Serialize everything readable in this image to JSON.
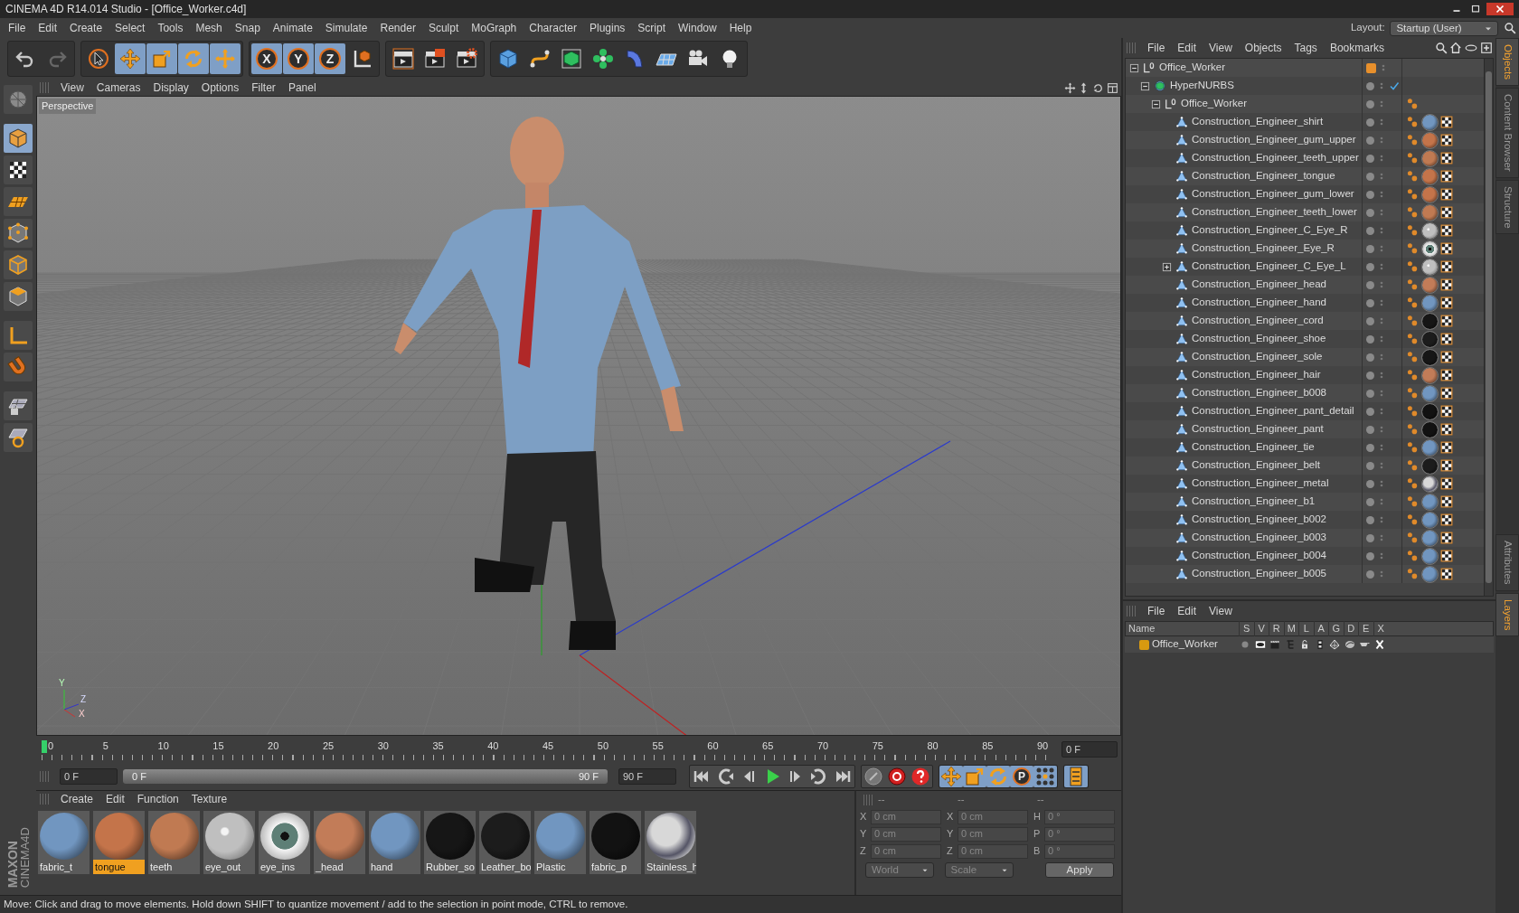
{
  "window": {
    "title": "CINEMA 4D R14.014 Studio - [Office_Worker.c4d]",
    "layout_label": "Layout:",
    "layout_value": "Startup (User)"
  },
  "menu": [
    "File",
    "Edit",
    "Create",
    "Select",
    "Tools",
    "Mesh",
    "Snap",
    "Animate",
    "Simulate",
    "Render",
    "Sculpt",
    "MoGraph",
    "Character",
    "Plugins",
    "Script",
    "Window",
    "Help"
  ],
  "toolbar": [
    [
      {
        "kind": "undo",
        "on": false,
        "disabled": false
      },
      {
        "kind": "redo",
        "on": false,
        "disabled": true
      }
    ],
    [
      {
        "kind": "select",
        "on": false
      },
      {
        "kind": "move",
        "on": true
      },
      {
        "kind": "scale",
        "on": true
      },
      {
        "kind": "rotate",
        "on": true
      },
      {
        "kind": "add",
        "on": true
      }
    ],
    [
      {
        "kind": "axis",
        "label": "X",
        "on": true
      },
      {
        "kind": "axis",
        "label": "Y",
        "on": true
      },
      {
        "kind": "axis",
        "label": "Z",
        "on": true
      },
      {
        "kind": "coord",
        "on": false
      }
    ],
    [
      {
        "kind": "render-view",
        "on": false
      },
      {
        "kind": "render-picture",
        "on": false
      },
      {
        "kind": "render-settings",
        "on": false
      }
    ],
    [
      {
        "kind": "cube",
        "on": false
      },
      {
        "kind": "spline",
        "on": false
      },
      {
        "kind": "nurbs",
        "on": false
      },
      {
        "kind": "array",
        "on": false
      },
      {
        "kind": "deformer",
        "on": false
      },
      {
        "kind": "floor",
        "on": false
      },
      {
        "kind": "camera",
        "on": false
      },
      {
        "kind": "light",
        "on": false
      }
    ]
  ],
  "tools": [
    {
      "kind": "editable",
      "on": false
    },
    {
      "kind": "model",
      "on": true
    },
    {
      "kind": "texture",
      "on": false
    },
    {
      "kind": "workplane",
      "on": false
    },
    {
      "kind": "points",
      "on": false
    },
    {
      "kind": "edges",
      "on": false
    },
    {
      "kind": "polygons",
      "on": false
    },
    {
      "kind": "axis-mode",
      "on": false
    },
    {
      "kind": "tweak",
      "on": false
    },
    {
      "kind": "snap",
      "on": false
    },
    {
      "kind": "snap-rotate",
      "on": false
    }
  ],
  "logo": {
    "brand": "MAXON",
    "product": "CINEMA4D"
  },
  "viewport": {
    "menu": [
      "View",
      "Cameras",
      "Display",
      "Options",
      "Filter",
      "Panel"
    ],
    "camera": "Perspective",
    "axis_labels": [
      "Y",
      "Z",
      "X"
    ]
  },
  "timeline": {
    "ticks": [
      "0",
      "5",
      "10",
      "15",
      "20",
      "25",
      "30",
      "35",
      "40",
      "45",
      "50",
      "55",
      "60",
      "65",
      "70",
      "75",
      "80",
      "85",
      "90"
    ],
    "playhead": {
      "level": 0
    },
    "frame_field": "0 F"
  },
  "playback": {
    "start_field": "0 F",
    "range_start": "0 F",
    "range_end": "90 F",
    "range": {
      "level": 1
    },
    "end_field": "90 F",
    "groups": [
      [
        {
          "kind": "to-start",
          "on": false
        },
        {
          "kind": "prev-key",
          "on": false
        },
        {
          "kind": "prev-frame",
          "on": false
        },
        {
          "kind": "play",
          "on": false
        },
        {
          "kind": "next-frame",
          "on": false
        },
        {
          "kind": "next-key",
          "on": false
        },
        {
          "kind": "to-end",
          "on": false
        }
      ],
      [
        {
          "kind": "key-off",
          "on": false
        },
        {
          "kind": "record",
          "on": false
        },
        {
          "kind": "autokey",
          "on": false
        }
      ],
      [
        {
          "kind": "move",
          "on": true
        },
        {
          "kind": "scale",
          "on": true
        },
        {
          "kind": "rotate",
          "on": true
        },
        {
          "kind": "param",
          "label": "P",
          "on": true
        },
        {
          "kind": "points-key",
          "on": true
        }
      ],
      [
        {
          "kind": "film",
          "on": true
        }
      ]
    ]
  },
  "materials": {
    "menu": [
      "Create",
      "Edit",
      "Function",
      "Texture"
    ],
    "items": [
      {
        "name": "fabric_t",
        "kind": "matte",
        "color": "#7196c0",
        "selected": false
      },
      {
        "name": "tongue",
        "kind": "matte",
        "color": "#c4744a",
        "selected": true
      },
      {
        "name": "teeth",
        "kind": "matte",
        "color": "#c07a52",
        "selected": false
      },
      {
        "name": "eye_out",
        "kind": "glass",
        "color": "#bfbfbf",
        "selected": false
      },
      {
        "name": "eye_ins",
        "kind": "eye",
        "color": "#5e7f76",
        "selected": false
      },
      {
        "name": "_head",
        "kind": "matte",
        "color": "#c27c58",
        "selected": false
      },
      {
        "name": "hand",
        "kind": "matte",
        "color": "#7196c0",
        "selected": false
      },
      {
        "name": "Rubber_so",
        "kind": "matte",
        "color": "#161616",
        "selected": false
      },
      {
        "name": "Leather_bo",
        "kind": "matte",
        "color": "#1c1c1c",
        "selected": false
      },
      {
        "name": "Plastic",
        "kind": "matte",
        "color": "#7196c0",
        "selected": false
      },
      {
        "name": "fabric_p",
        "kind": "matte",
        "color": "#121212",
        "selected": false
      },
      {
        "name": "Stainless_h",
        "kind": "chrome",
        "color": "#d8d8d8",
        "selected": false
      }
    ]
  },
  "coordinates": {
    "headers": [
      "--",
      "--",
      "--"
    ],
    "rows": [
      [
        {
          "label": "X",
          "value": "0 cm"
        },
        {
          "label": "X",
          "value": "0 cm"
        },
        {
          "label": "H",
          "value": "0 °"
        }
      ],
      [
        {
          "label": "Y",
          "value": "0 cm"
        },
        {
          "label": "Y",
          "value": "0 cm"
        },
        {
          "label": "P",
          "value": "0 °"
        }
      ],
      [
        {
          "label": "Z",
          "value": "0 cm"
        },
        {
          "label": "Z",
          "value": "0 cm"
        },
        {
          "label": "B",
          "value": "0 °"
        }
      ]
    ],
    "dropdowns": [
      "World",
      "Scale"
    ],
    "apply": "Apply"
  },
  "status_bar": "Move: Click and drag to move elements. Hold down SHIFT to quantize movement / add to the selection in point mode, CTRL to remove.",
  "objects": {
    "menu": [
      "File",
      "Edit",
      "View",
      "Objects",
      "Tags",
      "Bookmarks"
    ],
    "tree": [
      {
        "name": "Office_Worker",
        "kind": "null",
        "color": "#e8902c",
        "expanded": true,
        "children": [
          {
            "name": "HyperNURBS",
            "kind": "hypernurbs",
            "checked": true,
            "expanded": true,
            "children": [
              {
                "name": "Office_Worker",
                "kind": "null",
                "expanded": true,
                "tags": [
                  {
                    "kind": "texture"
                  }
                ],
                "children": [
                  {
                    "name": "Construction_Engineer_shirt",
                    "kind": "polygon",
                    "tags": [
                      {
                        "kind": "texture"
                      },
                      {
                        "kind": "matte",
                        "color": "#7196c0"
                      },
                      {
                        "kind": "uvw"
                      }
                    ]
                  },
                  {
                    "name": "Construction_Engineer_gum_upper",
                    "kind": "polygon",
                    "tags": [
                      {
                        "kind": "texture"
                      },
                      {
                        "kind": "matte",
                        "color": "#c4744a"
                      },
                      {
                        "kind": "uvw"
                      }
                    ]
                  },
                  {
                    "name": "Construction_Engineer_teeth_upper",
                    "kind": "polygon",
                    "tags": [
                      {
                        "kind": "texture"
                      },
                      {
                        "kind": "matte",
                        "color": "#c07a52"
                      },
                      {
                        "kind": "uvw"
                      }
                    ]
                  },
                  {
                    "name": "Construction_Engineer_tongue",
                    "kind": "polygon",
                    "tags": [
                      {
                        "kind": "texture"
                      },
                      {
                        "kind": "matte",
                        "color": "#c4744a"
                      },
                      {
                        "kind": "uvw"
                      }
                    ]
                  },
                  {
                    "name": "Construction_Engineer_gum_lower",
                    "kind": "polygon",
                    "tags": [
                      {
                        "kind": "texture"
                      },
                      {
                        "kind": "matte",
                        "color": "#c4744a"
                      },
                      {
                        "kind": "uvw"
                      }
                    ]
                  },
                  {
                    "name": "Construction_Engineer_teeth_lower",
                    "kind": "polygon",
                    "tags": [
                      {
                        "kind": "texture"
                      },
                      {
                        "kind": "matte",
                        "color": "#c07a52"
                      },
                      {
                        "kind": "uvw"
                      }
                    ]
                  },
                  {
                    "name": "Construction_Engineer_C_Eye_R",
                    "kind": "polygon",
                    "tags": [
                      {
                        "kind": "texture"
                      },
                      {
                        "kind": "glass",
                        "color": "#bfbfbf"
                      },
                      {
                        "kind": "uvw"
                      }
                    ]
                  },
                  {
                    "name": "Construction_Engineer_Eye_R",
                    "kind": "polygon",
                    "tags": [
                      {
                        "kind": "texture"
                      },
                      {
                        "kind": "eye",
                        "color": "#5e7f76"
                      },
                      {
                        "kind": "uvw"
                      }
                    ]
                  },
                  {
                    "name": "Construction_Engineer_C_Eye_L",
                    "kind": "polygon",
                    "expanded": false,
                    "tags": [
                      {
                        "kind": "texture"
                      },
                      {
                        "kind": "glass",
                        "color": "#bfbfbf"
                      },
                      {
                        "kind": "uvw"
                      }
                    ]
                  },
                  {
                    "name": "Construction_Engineer_head",
                    "kind": "polygon",
                    "tags": [
                      {
                        "kind": "texture"
                      },
                      {
                        "kind": "matte",
                        "color": "#c27c58"
                      },
                      {
                        "kind": "uvw"
                      }
                    ]
                  },
                  {
                    "name": "Construction_Engineer_hand",
                    "kind": "polygon",
                    "tags": [
                      {
                        "kind": "texture"
                      },
                      {
                        "kind": "matte",
                        "color": "#7196c0"
                      },
                      {
                        "kind": "uvw"
                      }
                    ]
                  },
                  {
                    "name": "Construction_Engineer_cord",
                    "kind": "polygon",
                    "tags": [
                      {
                        "kind": "texture"
                      },
                      {
                        "kind": "matte",
                        "color": "#161616"
                      },
                      {
                        "kind": "uvw"
                      }
                    ]
                  },
                  {
                    "name": "Construction_Engineer_shoe",
                    "kind": "polygon",
                    "tags": [
                      {
                        "kind": "texture"
                      },
                      {
                        "kind": "matte",
                        "color": "#1c1c1c"
                      },
                      {
                        "kind": "uvw"
                      }
                    ]
                  },
                  {
                    "name": "Construction_Engineer_sole",
                    "kind": "polygon",
                    "tags": [
                      {
                        "kind": "texture"
                      },
                      {
                        "kind": "matte",
                        "color": "#161616"
                      },
                      {
                        "kind": "uvw"
                      }
                    ]
                  },
                  {
                    "name": "Construction_Engineer_hair",
                    "kind": "polygon",
                    "tags": [
                      {
                        "kind": "texture"
                      },
                      {
                        "kind": "matte",
                        "color": "#c27c58"
                      },
                      {
                        "kind": "uvw"
                      }
                    ]
                  },
                  {
                    "name": "Construction_Engineer_b008",
                    "kind": "polygon",
                    "tags": [
                      {
                        "kind": "texture"
                      },
                      {
                        "kind": "matte",
                        "color": "#7196c0"
                      },
                      {
                        "kind": "uvw"
                      }
                    ]
                  },
                  {
                    "name": "Construction_Engineer_pant_detail",
                    "kind": "polygon",
                    "tags": [
                      {
                        "kind": "texture"
                      },
                      {
                        "kind": "matte",
                        "color": "#121212"
                      },
                      {
                        "kind": "uvw"
                      }
                    ]
                  },
                  {
                    "name": "Construction_Engineer_pant",
                    "kind": "polygon",
                    "tags": [
                      {
                        "kind": "texture"
                      },
                      {
                        "kind": "matte",
                        "color": "#121212"
                      },
                      {
                        "kind": "uvw"
                      }
                    ]
                  },
                  {
                    "name": "Construction_Engineer_tie",
                    "kind": "polygon",
                    "tags": [
                      {
                        "kind": "texture"
                      },
                      {
                        "kind": "matte",
                        "color": "#7196c0"
                      },
                      {
                        "kind": "uvw"
                      }
                    ]
                  },
                  {
                    "name": "Construction_Engineer_belt",
                    "kind": "polygon",
                    "tags": [
                      {
                        "kind": "texture"
                      },
                      {
                        "kind": "matte",
                        "color": "#1c1c1c"
                      },
                      {
                        "kind": "uvw"
                      }
                    ]
                  },
                  {
                    "name": "Construction_Engineer_metal",
                    "kind": "polygon",
                    "tags": [
                      {
                        "kind": "texture"
                      },
                      {
                        "kind": "chrome",
                        "color": "#d8d8d8"
                      },
                      {
                        "kind": "uvw"
                      }
                    ]
                  },
                  {
                    "name": "Construction_Engineer_b1",
                    "kind": "polygon",
                    "tags": [
                      {
                        "kind": "texture"
                      },
                      {
                        "kind": "matte",
                        "color": "#7196c0"
                      },
                      {
                        "kind": "uvw"
                      }
                    ]
                  },
                  {
                    "name": "Construction_Engineer_b002",
                    "kind": "polygon",
                    "tags": [
                      {
                        "kind": "texture"
                      },
                      {
                        "kind": "matte",
                        "color": "#7196c0"
                      },
                      {
                        "kind": "uvw"
                      }
                    ]
                  },
                  {
                    "name": "Construction_Engineer_b003",
                    "kind": "polygon",
                    "tags": [
                      {
                        "kind": "texture"
                      },
                      {
                        "kind": "matte",
                        "color": "#7196c0"
                      },
                      {
                        "kind": "uvw"
                      }
                    ]
                  },
                  {
                    "name": "Construction_Engineer_b004",
                    "kind": "polygon",
                    "tags": [
                      {
                        "kind": "texture"
                      },
                      {
                        "kind": "matte",
                        "color": "#7196c0"
                      },
                      {
                        "kind": "uvw"
                      }
                    ]
                  },
                  {
                    "name": "Construction_Engineer_b005",
                    "kind": "polygon",
                    "tags": [
                      {
                        "kind": "texture"
                      },
                      {
                        "kind": "matte",
                        "color": "#7196c0"
                      },
                      {
                        "kind": "uvw"
                      }
                    ]
                  }
                ]
              }
            ]
          }
        ]
      }
    ]
  },
  "side_tabs_top": [
    {
      "label": "Objects",
      "selected": true
    },
    {
      "label": "Content Browser",
      "selected": false
    },
    {
      "label": "Structure",
      "selected": false
    }
  ],
  "layers": {
    "menu": [
      "File",
      "Edit",
      "View"
    ],
    "columns": [
      "Name",
      "S",
      "V",
      "R",
      "M",
      "L",
      "A",
      "G",
      "D",
      "E",
      "X"
    ],
    "rows": [
      {
        "name": "Office_Worker",
        "color": "#d89a10"
      }
    ]
  },
  "side_tabs_bottom": [
    {
      "label": "Attributes",
      "selected": false
    },
    {
      "label": "Layers",
      "selected": true
    }
  ]
}
